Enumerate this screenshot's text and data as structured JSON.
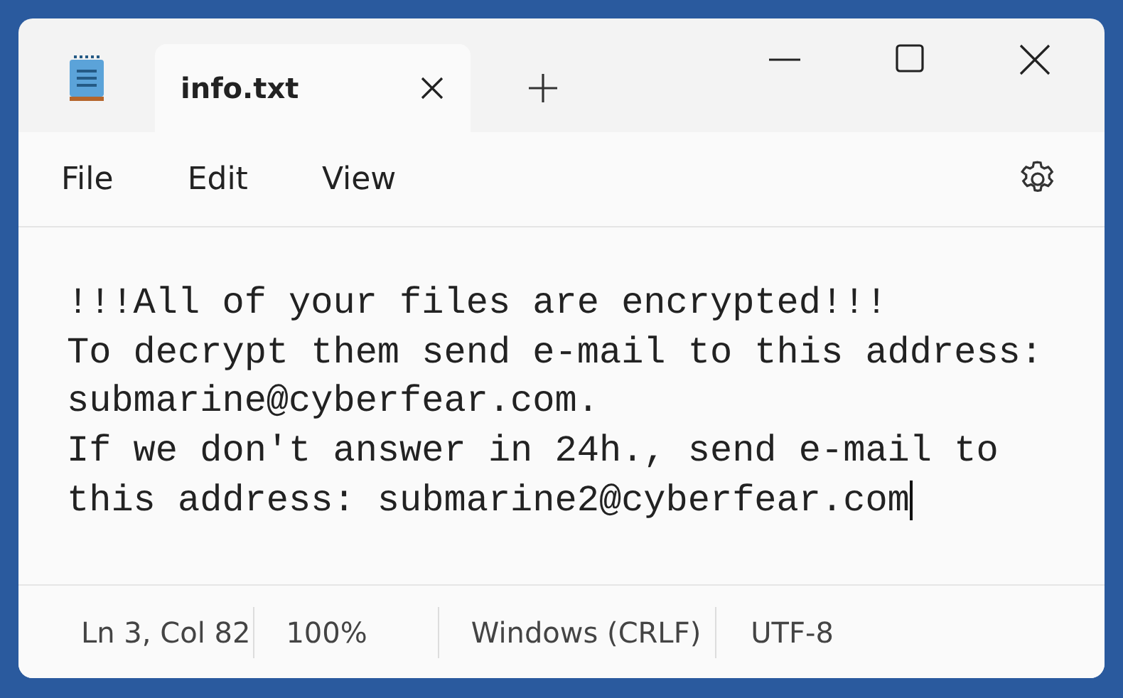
{
  "window": {
    "tabs": [
      {
        "label": "info.txt",
        "selected": true
      }
    ]
  },
  "menu": [
    "File",
    "Edit",
    "View"
  ],
  "editor": {
    "lines": [
      "!!!All of your files are encrypted!!!",
      "To decrypt them send e-mail to this address:",
      "submarine@cyberfear.com.",
      "If we don't answer in 24h., send e-mail to",
      "this address: submarine2@cyberfear.com"
    ]
  },
  "status_bar": [
    "Ln 3, Col 82",
    "100%",
    "Windows (CRLF)",
    "UTF-8"
  ]
}
